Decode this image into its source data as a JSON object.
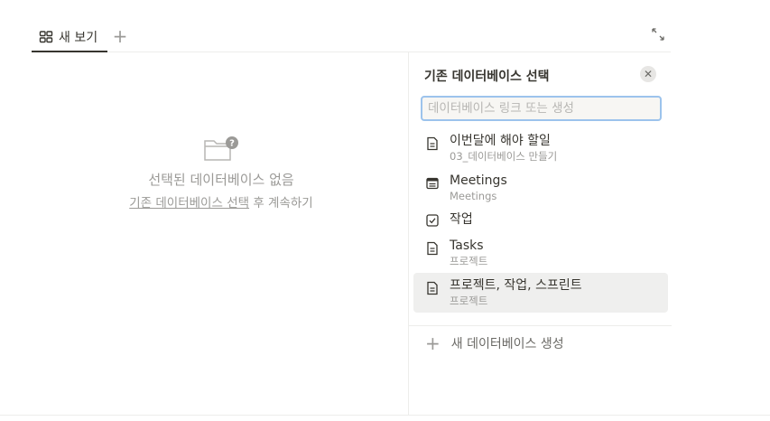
{
  "tabs": {
    "view_label": "새 보기",
    "add_label": "+"
  },
  "empty_state": {
    "title": "선택된 데이터베이스 없음",
    "sub_link": "기존 데이터베이스 선택",
    "sub_rest": " 후 계속하기"
  },
  "panel": {
    "title": "기존 데이터베이스 선택",
    "close_label": "✕",
    "search_placeholder": "데이터베이스 링크 또는 생성",
    "items": [
      {
        "name": "이번달에 해야 할일",
        "path": "03_데이터베이스 만들기",
        "icon": "page-icon"
      },
      {
        "name": "Meetings",
        "path": "Meetings",
        "icon": "calendar-icon"
      },
      {
        "name": "작업",
        "path": "",
        "icon": "checkbox-icon"
      },
      {
        "name": "Tasks",
        "path": "프로젝트",
        "icon": "page-icon"
      },
      {
        "name": "프로젝트, 작업, 스프린트",
        "path": "프로젝트",
        "icon": "page-icon"
      }
    ],
    "new_db_label": "새 데이터베이스 생성"
  }
}
